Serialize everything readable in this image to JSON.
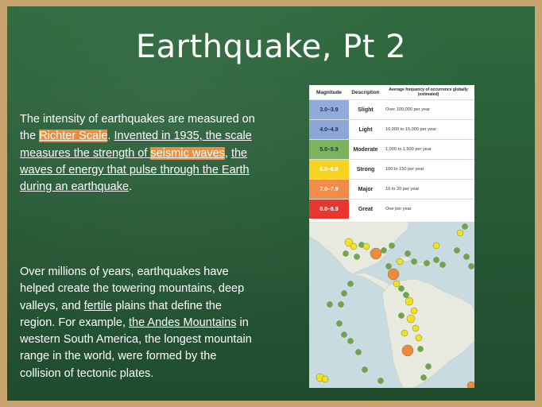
{
  "slide": {
    "title": "Earthquake, Pt 2",
    "p1": {
      "a": "The intensity of earthquakes are measured on the ",
      "richter": "Richter Scale",
      "b": ". ",
      "c": "Invented in 1935, the scale measures the strength of ",
      "seismic": "seismic waves",
      "d": ", ",
      "e": "the waves of energy that pulse through the Earth during an earthquake",
      "f": "."
    },
    "p2": {
      "a": "Over millions of years, earthquakes have helped create the towering mountains, deep valleys, and ",
      "fertile": "fertile",
      "b": " plains that define the region. For example, ",
      "andes": "the Andes Mountains",
      "c": " in western South America, the longest mountain range in the world, were formed by the collision of tectonic plates."
    }
  },
  "magnitude_table": {
    "headers": {
      "magnitude": "Magnitude",
      "description": "Description",
      "frequency": "Average frequency of occurrence globally (estimated)"
    },
    "rows": [
      {
        "magnitude": "3.0–3.9",
        "description": "Slight",
        "frequency": "Over 100,000 per year",
        "color": "#8fa9d9"
      },
      {
        "magnitude": "4.0–4.9",
        "description": "Light",
        "frequency": "10,000 to 15,000 per year",
        "color": "#88a4d6"
      },
      {
        "magnitude": "5.0–5.9",
        "description": "Moderate",
        "frequency": "1,000 to 1,500 per year",
        "color": "#79b05a"
      },
      {
        "magnitude": "6.0–6.9",
        "description": "Strong",
        "frequency": "100 to 150 per year",
        "color": "#f5d21a"
      },
      {
        "magnitude": "7.0–7.9",
        "description": "Major",
        "frequency": "10 to 20 per year",
        "color": "#f08a47"
      },
      {
        "magnitude": "8.0–8.9",
        "description": "Great",
        "frequency": "One per year",
        "color": "#e8322b"
      }
    ]
  },
  "map": {
    "ocean_color": "#c7dbe0",
    "land_color": "#e9eadf",
    "marker_colors": {
      "moderate": "#6ea846",
      "strong": "#f4e022",
      "major": "#ee8a3d"
    }
  }
}
